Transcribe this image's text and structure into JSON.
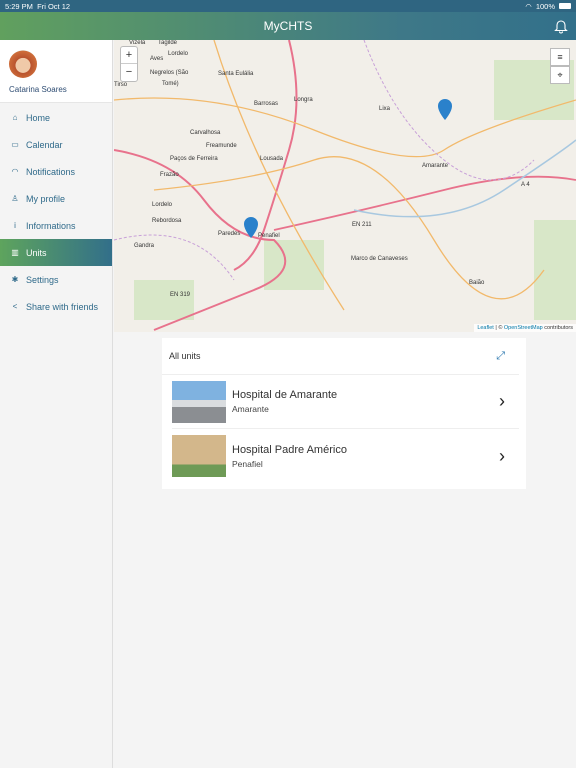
{
  "status": {
    "time": "5:29 PM",
    "date": "Fri Oct 12",
    "battery": "100%"
  },
  "header": {
    "title": "MyCHTS",
    "icon": "bell-icon"
  },
  "sidebar": {
    "user": "Catarina Soares",
    "items": [
      {
        "label": "Home",
        "icon": "home-icon",
        "glyph": "⌂"
      },
      {
        "label": "Calendar",
        "icon": "calendar-icon",
        "glyph": "▭"
      },
      {
        "label": "Notifications",
        "icon": "bell-icon",
        "glyph": "◠"
      },
      {
        "label": "My profile",
        "icon": "user-icon",
        "glyph": "♙"
      },
      {
        "label": "Informations",
        "icon": "info-icon",
        "glyph": "i"
      },
      {
        "label": "Units",
        "icon": "map-icon",
        "glyph": "▥",
        "active": true
      },
      {
        "label": "Settings",
        "icon": "gear-icon",
        "glyph": "✱"
      },
      {
        "label": "Share with friends",
        "icon": "share-icon",
        "glyph": "<"
      }
    ]
  },
  "map": {
    "zoom_in": "+",
    "zoom_out": "−",
    "layers": "≡",
    "locate": "⌖",
    "attribution": {
      "leaflet": "Leaflet",
      "sep": " | © ",
      "osm": "OpenStreetMap",
      "rest": " contributors"
    },
    "places": [
      "Vizela",
      "Tagilde",
      "Lordelo",
      "Aves",
      "Negrelos (São",
      "Tomé)",
      "Santa Eulália",
      "Tirso",
      "Barrosas",
      "Longra",
      "Lixa",
      "Carvalhosa",
      "Freamunde",
      "Paços de Ferreira",
      "Lousada",
      "Frazão",
      "Amarante",
      "A 4",
      "Lordelo",
      "Rebordosa",
      "EN 211",
      "Paredes",
      "Penafiel",
      "Gandra",
      "Marco de Canaveses",
      "EN 319",
      "Baião"
    ]
  },
  "units": {
    "title": "All units",
    "items": [
      {
        "name": "Hospital de Amarante",
        "city": "Amarante"
      },
      {
        "name": "Hospital Padre Américo",
        "city": "Penafiel"
      }
    ]
  },
  "colors": {
    "accent": "#2f6a8a",
    "green": "#61a05e",
    "marker": "#2a81cb"
  }
}
